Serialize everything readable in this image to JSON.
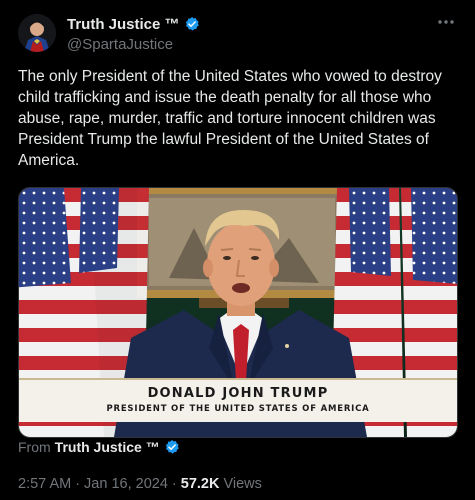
{
  "author": {
    "display_name": "Truth Justice ™",
    "handle": "@SpartaJustice",
    "verified": true
  },
  "more_icon": "ellipsis-icon",
  "post_text": "The only President of the United States who vowed to destroy child trafficking and issue the death penalty for all those who abuse, rape, murder, traffic and torture innocent children was President Trump the lawful President of the United States of America.",
  "media": {
    "caption_name": "DONALD JOHN TRUMP",
    "caption_title": "PRESIDENT OF THE UNITED STATES OF AMERICA"
  },
  "attribution": {
    "from_label": "From",
    "from_name": "Truth Justice ™"
  },
  "meta": {
    "time": "2:57 AM",
    "separator": "·",
    "date": "Jan 16, 2024",
    "views_count": "57.2K",
    "views_label": "Views"
  },
  "colors": {
    "background": "#000000",
    "text_primary": "#e7e9ea",
    "text_secondary": "#71767b",
    "verified_badge": "#1d9bf0"
  }
}
